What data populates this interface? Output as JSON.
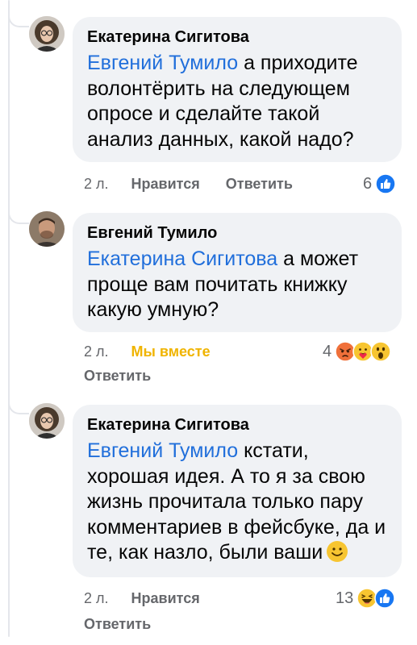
{
  "comments": [
    {
      "author": "Екатерина Сигитова",
      "mention": "Евгений Тумило",
      "text": " а приходите волонтёрить на следующем опросе и сделайте такой анализ данных, какой надо?",
      "time": "2 л.",
      "action_primary": "Нравится",
      "action_reply": "Ответить",
      "reaction_count": "6",
      "reactions": [
        "like-reaction-icon"
      ]
    },
    {
      "author": "Евгений Тумило",
      "mention": "Екатерина Сигитова",
      "text": " а может проще вам почитать книжку какую умную?",
      "time": "2 л.",
      "action_primary": "Мы вместе",
      "action_reply": "Ответить",
      "reaction_count": "4",
      "reactions": [
        "angry-reaction-icon",
        "care-reaction-icon",
        "wow-reaction-icon"
      ]
    },
    {
      "author": "Екатерина Сигитова",
      "mention": "Евгений Тумило",
      "text": " кстати, хорошая идея. А то я за свою жизнь прочитала только пару комментариев в фейсбуке, да и те, как назло, были ваши",
      "time": "2 л.",
      "action_primary": "Нравится",
      "action_reply": "Ответить",
      "reaction_count": "13",
      "reactions": [
        "haha-reaction-icon",
        "like-reaction-icon"
      ]
    }
  ],
  "colors": {
    "mention": "#216fdb",
    "bubble": "#f0f2f5",
    "secondary_text": "#65676b",
    "together_action": "#f0b400",
    "like_blue": "#1877f2"
  }
}
